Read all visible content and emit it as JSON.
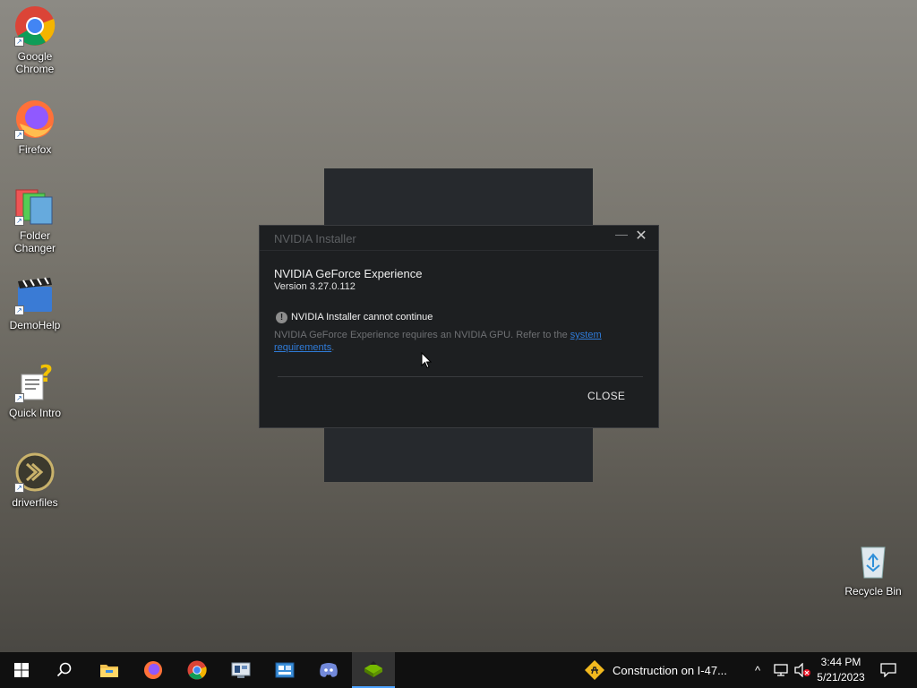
{
  "desktop": {
    "icons": [
      {
        "label_line1": "Google",
        "label_line2": "Chrome"
      },
      {
        "label_line1": "Firefox",
        "label_line2": ""
      },
      {
        "label_line1": "Folder",
        "label_line2": "Changer"
      },
      {
        "label_line1": "DemoHelp",
        "label_line2": ""
      },
      {
        "label_line1": "Quick Intro",
        "label_line2": ""
      },
      {
        "label_line1": "driverfiles",
        "label_line2": ""
      },
      {
        "label_line1": "Recycle Bin",
        "label_line2": ""
      }
    ]
  },
  "dialog": {
    "title": "NVIDIA Installer",
    "minimize_glyph": "—",
    "close_glyph": "✕",
    "product_name": "NVIDIA GeForce Experience",
    "version": "Version 3.27.0.112",
    "error_icon": "!",
    "error_title": "NVIDIA Installer cannot continue",
    "error_text": "NVIDIA GeForce Experience requires an NVIDIA GPU. Refer to the",
    "link_text": "system requirements",
    "error_text_end": ".",
    "close_button": "CLOSE"
  },
  "taskbar": {
    "notification": "Construction on I-47...",
    "tray_chevron": "^",
    "time": "3:44 PM",
    "date": "5/21/2023"
  },
  "colors": {
    "taskbar_bg": "#101010",
    "dialog_bg": "#1d1f21",
    "link": "#2f7bd8",
    "nvidia_green": "#76b900"
  }
}
